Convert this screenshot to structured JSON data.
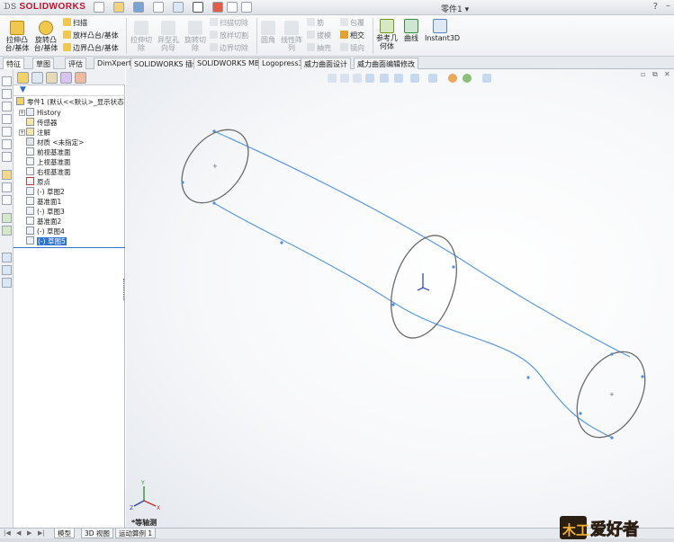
{
  "app": {
    "logo": "SOLIDWORKS",
    "document_title": "零件1",
    "title_arrow": "▾",
    "help_label": "?",
    "window_control": "–"
  },
  "ribbon": {
    "large_buttons": [
      {
        "label": "拉伸凸\n台/基体",
        "icon": "extruded-boss-icon",
        "enabled": true
      },
      {
        "label": "旋转凸\n台/基体",
        "icon": "revolved-boss-icon",
        "enabled": true
      },
      {
        "label": "拉伸切\n除",
        "icon": "extruded-cut-icon",
        "enabled": false
      },
      {
        "label": "异型孔\n向导",
        "icon": "hole-wizard-icon",
        "enabled": false
      },
      {
        "label": "旋转切\n除",
        "icon": "revolved-cut-icon",
        "enabled": false
      },
      {
        "label": "圆角",
        "icon": "fillet-icon",
        "enabled": false
      },
      {
        "label": "线性阵\n列",
        "icon": "linear-pattern-icon",
        "enabled": false
      },
      {
        "label": "参考几\n何体",
        "icon": "reference-geometry-icon",
        "enabled": true
      },
      {
        "label": "曲线",
        "icon": "curves-icon",
        "enabled": true
      },
      {
        "label": "Instant3D",
        "icon": "instant3d-icon",
        "enabled": true
      }
    ],
    "small_group1": [
      {
        "label": "扫描",
        "icon": "sweep-icon",
        "enabled": true
      },
      {
        "label": "放样凸台/基体",
        "icon": "loft-icon",
        "enabled": true
      },
      {
        "label": "边界凸台/基体",
        "icon": "boundary-boss-icon",
        "enabled": true
      }
    ],
    "small_group2": [
      {
        "label": "扫描切除",
        "icon": "swept-cut-icon",
        "enabled": false
      },
      {
        "label": "放样切割",
        "icon": "lofted-cut-icon",
        "enabled": false
      },
      {
        "label": "边界切除",
        "icon": "boundary-cut-icon",
        "enabled": false
      }
    ],
    "small_group3": [
      {
        "label": "筋",
        "icon": "rib-icon",
        "enabled": false
      },
      {
        "label": "拔模",
        "icon": "draft-icon",
        "enabled": false
      },
      {
        "label": "抽壳",
        "icon": "shell-icon",
        "enabled": false
      }
    ],
    "small_group4": [
      {
        "label": "包覆",
        "icon": "wrap-icon",
        "enabled": false
      },
      {
        "label": "相交",
        "icon": "intersect-icon",
        "enabled": true
      },
      {
        "label": "镜向",
        "icon": "mirror-icon",
        "enabled": false
      }
    ]
  },
  "tabs": [
    "特征",
    "草图",
    "评估",
    "DimXpert",
    "SOLIDWORKS 插件",
    "SOLIDWORKS MBD",
    "Logopress3",
    "威力曲面设计",
    "威力曲面编辑修改"
  ],
  "active_tab": 0,
  "feature_tree": {
    "root": "零件1 (默认<<默认>_显示状态",
    "items": [
      {
        "label": "History",
        "icon": "history-icon",
        "expand": "+"
      },
      {
        "label": "传感器",
        "icon": "sensor-icon",
        "expand": ""
      },
      {
        "label": "注解",
        "icon": "annotations-icon",
        "expand": "+"
      },
      {
        "label": "材质 <未指定>",
        "icon": "material-icon",
        "expand": ""
      },
      {
        "label": "前视基准面",
        "icon": "plane-icon",
        "expand": ""
      },
      {
        "label": "上视基准面",
        "icon": "plane-icon",
        "expand": ""
      },
      {
        "label": "右视基准面",
        "icon": "plane-icon",
        "expand": ""
      },
      {
        "label": "原点",
        "icon": "origin-icon",
        "expand": ""
      },
      {
        "label": "(-) 草图2",
        "icon": "sketch-icon",
        "expand": ""
      },
      {
        "label": "基准面1",
        "icon": "plane-icon",
        "expand": ""
      },
      {
        "label": "(-) 草图3",
        "icon": "sketch-icon",
        "expand": ""
      },
      {
        "label": "基准面2",
        "icon": "plane-icon",
        "expand": ""
      },
      {
        "label": "(-) 草图4",
        "icon": "sketch-icon",
        "expand": ""
      },
      {
        "label": "(-) 草图5",
        "icon": "sketch-icon",
        "expand": "",
        "selected": true
      }
    ]
  },
  "viewport": {
    "view_name": "*等轴测",
    "sketch_color": "#5a9be0",
    "profile_color": "#6b6b6b",
    "triad_labels": {
      "x": "X",
      "y": "Y",
      "z": "Z"
    }
  },
  "bottom_tabs": [
    "模型",
    "3D 视图",
    "运动算例 1"
  ],
  "active_bottom_tab": 0,
  "watermark": {
    "text": "爱好者",
    "prefix": "木工"
  }
}
